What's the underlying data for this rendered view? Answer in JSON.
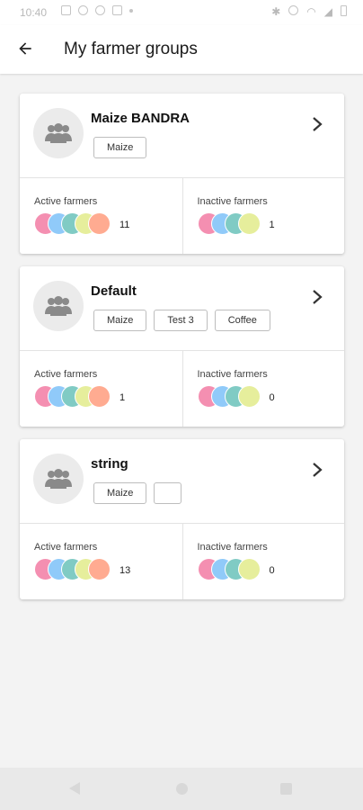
{
  "status_bar": {
    "time": "10:40"
  },
  "app_bar": {
    "title": "My farmer groups",
    "back_icon": "arrow-left-icon"
  },
  "colors": {
    "bubble_colors": [
      "#f48fb1",
      "#90caf9",
      "#80cbc4",
      "#e6ee9c",
      "#ffab91"
    ]
  },
  "groups": [
    {
      "name": "Maize BANDRA",
      "tags": [
        "Maize"
      ],
      "active_label": "Active farmers",
      "active_count": "11",
      "inactive_label": "Inactive farmers",
      "inactive_count": "1"
    },
    {
      "name": "Default",
      "tags": [
        "Maize",
        "Test 3",
        "Coffee"
      ],
      "active_label": "Active farmers",
      "active_count": "1",
      "inactive_label": "Inactive farmers",
      "inactive_count": "0"
    },
    {
      "name": "string",
      "tags": [
        "Maize",
        ""
      ],
      "active_label": "Active farmers",
      "active_count": "13",
      "inactive_label": "Inactive farmers",
      "inactive_count": "0"
    }
  ]
}
